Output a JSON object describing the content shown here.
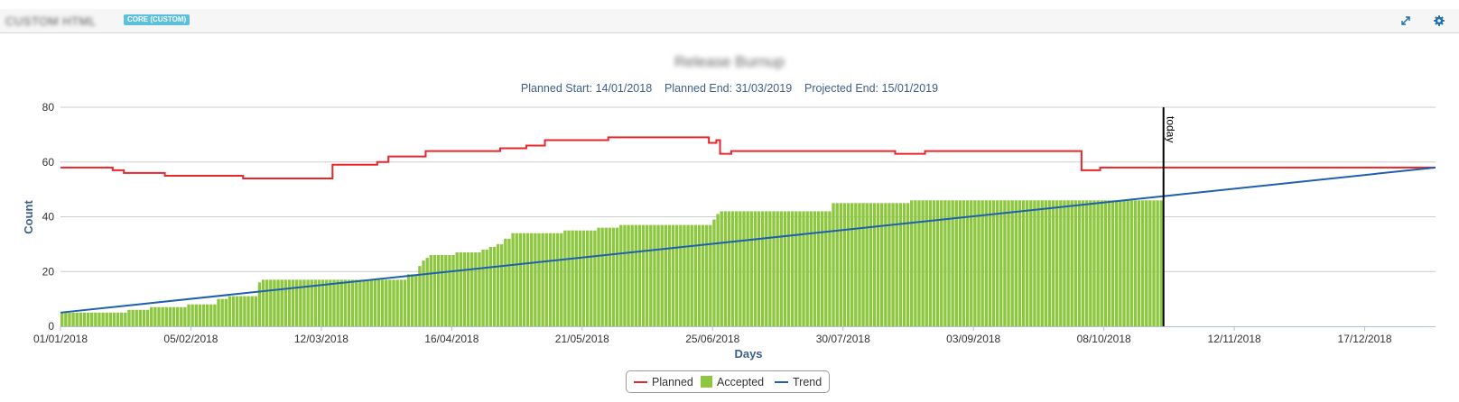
{
  "panel": {
    "title": "CUSTOM HTML",
    "badge": "CORE (CUSTOM)",
    "expand_icon": "expand-icon",
    "settings_icon": "gear-icon"
  },
  "chart_title": "Release Burnup",
  "subtitle": "Planned Start: 14/01/2018    Planned End: 31/03/2019    Projected End: 15/01/2019",
  "colors": {
    "planned": "#e8262b",
    "accepted": "#8dc63f",
    "trend": "#1f5fb0",
    "today": "#000000",
    "axis_text": "#333333",
    "axis_title": "#3e5e8a",
    "grid": "#cccccc"
  },
  "chart_data": {
    "type": "bar",
    "xlabel": "Days",
    "ylabel": "Count",
    "ylim": [
      0,
      80
    ],
    "yticks": [
      0,
      20,
      40,
      60,
      80
    ],
    "x_start": "01/01/2018",
    "x_end": "05/01/2019",
    "xtick_labels": [
      "01/01/2018",
      "05/02/2018",
      "12/03/2018",
      "16/04/2018",
      "21/05/2018",
      "25/06/2018",
      "30/07/2018",
      "03/09/2018",
      "08/10/2018",
      "12/11/2018",
      "17/12/2018"
    ],
    "today": {
      "label": "today",
      "date": "24/10/2018"
    },
    "legend": [
      "Planned",
      "Accepted",
      "Trend"
    ],
    "series": [
      {
        "name": "Planned",
        "type": "step-line",
        "points": [
          [
            "01/01/2018",
            58
          ],
          [
            "15/01/2018",
            57
          ],
          [
            "18/01/2018",
            56
          ],
          [
            "29/01/2018",
            55
          ],
          [
            "19/02/2018",
            54
          ],
          [
            "15/03/2018",
            59
          ],
          [
            "27/03/2018",
            60
          ],
          [
            "30/03/2018",
            62
          ],
          [
            "09/04/2018",
            64
          ],
          [
            "29/04/2018",
            65
          ],
          [
            "06/05/2018",
            66
          ],
          [
            "11/05/2018",
            68
          ],
          [
            "28/05/2018",
            69
          ],
          [
            "24/06/2018",
            67
          ],
          [
            "26/06/2018",
            68
          ],
          [
            "27/06/2018",
            63
          ],
          [
            "30/06/2018",
            64
          ],
          [
            "13/08/2018",
            63
          ],
          [
            "21/08/2018",
            64
          ],
          [
            "02/10/2018",
            57
          ],
          [
            "07/10/2018",
            58
          ],
          [
            "05/01/2019",
            58
          ]
        ]
      },
      {
        "name": "Accepted",
        "type": "daily-bars",
        "end": "23/10/2018",
        "steps": [
          [
            "01/01/2018",
            5
          ],
          [
            "19/01/2018",
            6
          ],
          [
            "25/01/2018",
            7
          ],
          [
            "04/02/2018",
            8
          ],
          [
            "12/02/2018",
            10
          ],
          [
            "15/02/2018",
            11
          ],
          [
            "23/02/2018",
            16
          ],
          [
            "24/02/2018",
            17
          ],
          [
            "09/03/2018",
            17
          ],
          [
            "22/03/2018",
            17
          ],
          [
            "04/04/2018",
            19
          ],
          [
            "07/04/2018",
            22
          ],
          [
            "08/04/2018",
            24
          ],
          [
            "09/04/2018",
            25
          ],
          [
            "10/04/2018",
            26
          ],
          [
            "17/04/2018",
            27
          ],
          [
            "24/04/2018",
            28
          ],
          [
            "26/04/2018",
            29
          ],
          [
            "28/04/2018",
            30
          ],
          [
            "30/04/2018",
            32
          ],
          [
            "02/05/2018",
            34
          ],
          [
            "16/05/2018",
            35
          ],
          [
            "25/05/2018",
            36
          ],
          [
            "31/05/2018",
            37
          ],
          [
            "25/06/2018",
            39
          ],
          [
            "26/06/2018",
            41
          ],
          [
            "27/06/2018",
            42
          ],
          [
            "27/07/2018",
            45
          ],
          [
            "17/08/2018",
            46
          ],
          [
            "23/10/2018",
            46
          ]
        ]
      },
      {
        "name": "Trend",
        "type": "line",
        "points": [
          [
            "01/01/2018",
            5
          ],
          [
            "05/01/2019",
            58
          ]
        ]
      }
    ]
  }
}
